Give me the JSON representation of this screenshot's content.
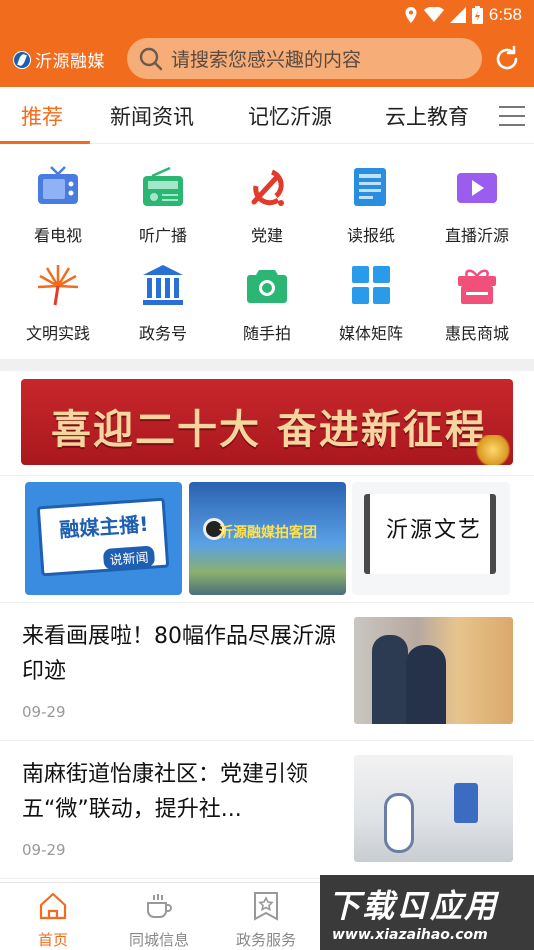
{
  "status_bar": {
    "time": "6:58"
  },
  "header": {
    "logo_text": "沂源融媒",
    "search_placeholder": "请搜索您感兴趣的内容"
  },
  "tabs": [
    {
      "label": "推荐",
      "active": true
    },
    {
      "label": "新闻资讯",
      "active": false
    },
    {
      "label": "记忆沂源",
      "active": false
    },
    {
      "label": "云上教育",
      "active": false
    }
  ],
  "grid": [
    {
      "label": "看电视",
      "icon": "tv-icon"
    },
    {
      "label": "听广播",
      "icon": "radio-icon"
    },
    {
      "label": "党建",
      "icon": "party-emblem-icon"
    },
    {
      "label": "读报纸",
      "icon": "newspaper-icon"
    },
    {
      "label": "直播沂源",
      "icon": "live-video-icon"
    },
    {
      "label": "文明实践",
      "icon": "civilization-fan-icon"
    },
    {
      "label": "政务号",
      "icon": "government-building-icon"
    },
    {
      "label": "随手拍",
      "icon": "camera-icon"
    },
    {
      "label": "媒体矩阵",
      "icon": "matrix-grid-icon"
    },
    {
      "label": "惠民商城",
      "icon": "gift-shop-icon"
    }
  ],
  "banner": {
    "text": "喜迎二十大 奋进新征程"
  },
  "features": [
    {
      "title": "融媒主播!",
      "subtitle": "说新闻"
    },
    {
      "title": "沂源融媒拍客团"
    },
    {
      "title": "沂源文艺"
    }
  ],
  "news": [
    {
      "title": "来看画展啦！80幅作品尽展沂源印迹",
      "date": "09-29"
    },
    {
      "title": "南麻街道怡康社区：党建引领 五“微”联动，提升社...",
      "date": "09-29"
    }
  ],
  "bottom_nav": [
    {
      "label": "首页",
      "icon": "home-icon",
      "active": true
    },
    {
      "label": "同城信息",
      "icon": "coffee-cup-icon",
      "active": false
    },
    {
      "label": "政务服务",
      "icon": "star-badge-icon",
      "active": false
    }
  ],
  "watermark": {
    "main": "下载ㄖ应用",
    "url": "www.xiazaihao.com"
  },
  "colors": {
    "accent": "#f26c1d",
    "search_bg": "#f6ad77",
    "banner_red": "#c8272b"
  }
}
